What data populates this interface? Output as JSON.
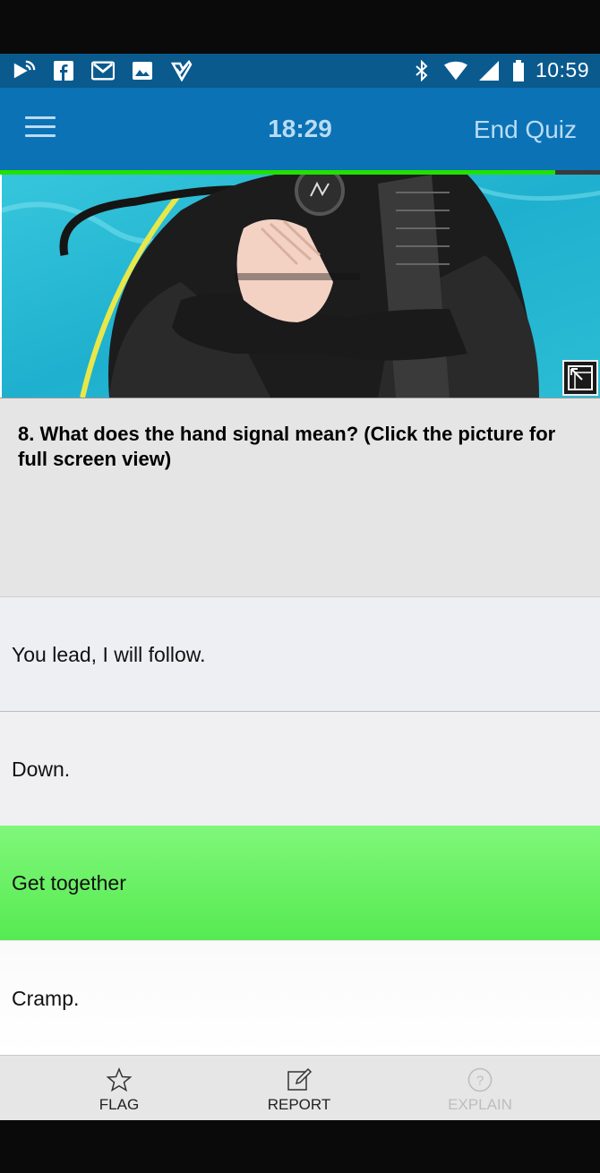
{
  "status_bar": {
    "time": "10:59",
    "left_icons": [
      "cast-icon",
      "facebook-icon",
      "gmail-icon",
      "image-icon",
      "check-icon"
    ],
    "right_icons": [
      "bluetooth-icon",
      "wifi-icon",
      "signal-icon",
      "battery-icon"
    ]
  },
  "app_bar": {
    "timer": "18:29",
    "end_quiz_label": "End Quiz"
  },
  "progress": {
    "fraction": 0.925,
    "color": "#22e000"
  },
  "question": {
    "text": "8. What does the hand signal mean? (Click the picture for full screen view)"
  },
  "answers": [
    {
      "label": "You lead, I will follow.",
      "selected": false
    },
    {
      "label": "Down.",
      "selected": false
    },
    {
      "label": "Get together",
      "selected": true
    },
    {
      "label": "Cramp.",
      "selected": false
    }
  ],
  "bottom_nav": [
    {
      "label": "FLAG",
      "icon": "star-icon",
      "enabled": true
    },
    {
      "label": "REPORT",
      "icon": "edit-icon",
      "enabled": true
    },
    {
      "label": "EXPLAIN",
      "icon": "help-icon",
      "enabled": false
    }
  ],
  "colors": {
    "status_bar": "#0a5a8e",
    "app_bar": "#0b72b5",
    "header_text": "#b9dcf4",
    "correct_answer": "#5cec57"
  }
}
